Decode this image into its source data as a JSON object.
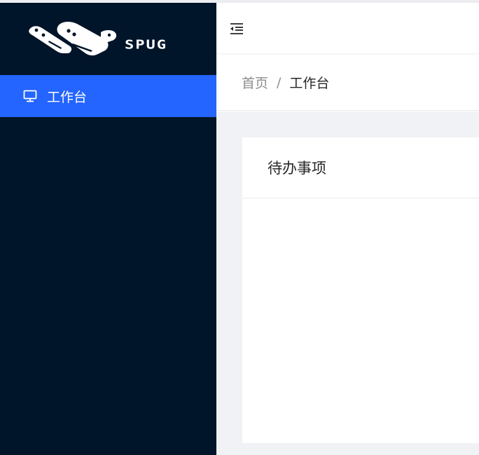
{
  "app": {
    "logo_text": "SPUG"
  },
  "sidebar": {
    "items": [
      {
        "label": "工作台",
        "icon": "desktop-icon",
        "active": true
      }
    ]
  },
  "header": {
    "collapse_icon": "menu-fold-icon"
  },
  "breadcrumb": {
    "home": "首页",
    "separator": "/",
    "current": "工作台"
  },
  "main": {
    "card_title": "待办事项"
  },
  "colors": {
    "sidebar_bg": "#001529",
    "active_item_bg": "#2464ff",
    "content_bg": "#f0f2f5"
  }
}
